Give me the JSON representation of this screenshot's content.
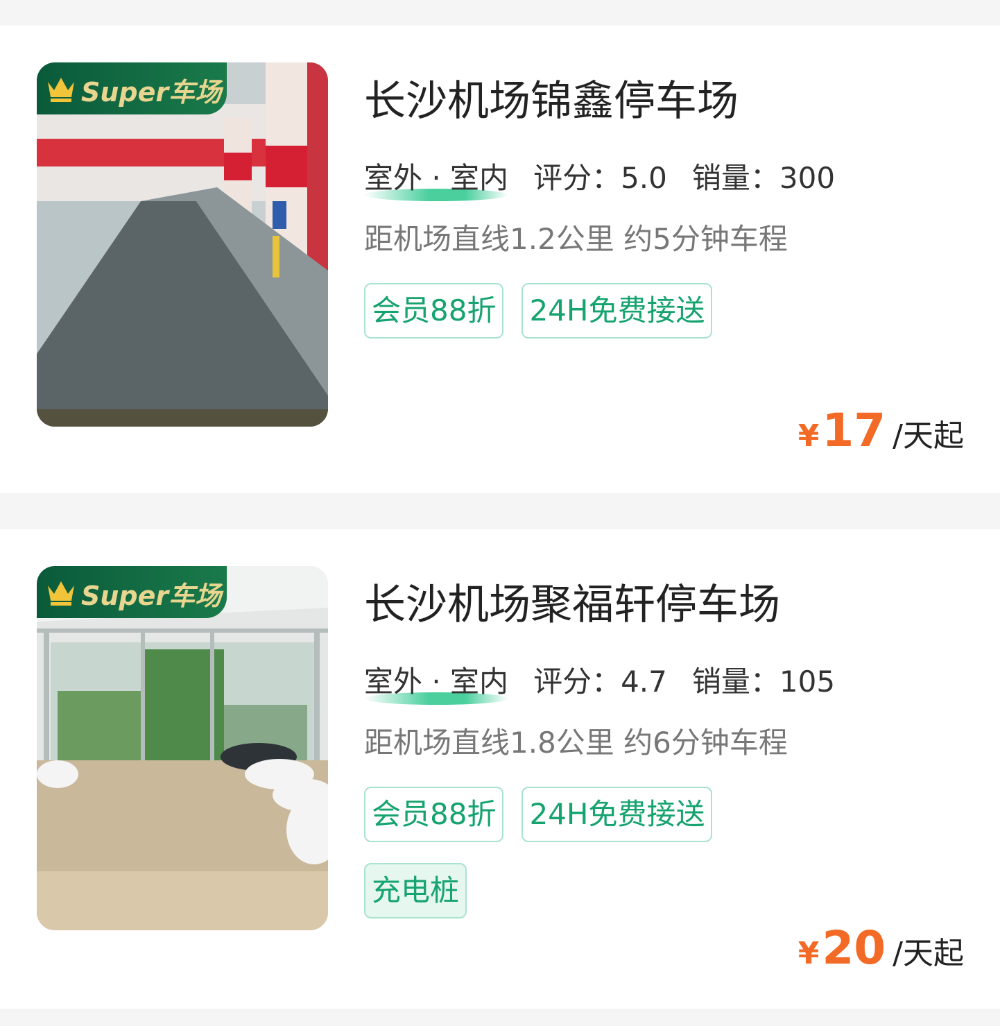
{
  "lots": [
    {
      "badge": "Super车场",
      "name": "长沙机场锦鑫停车场",
      "type_label": "室外 · 室内",
      "rating_label": "评分：",
      "rating": "5.0",
      "sales_label": "销量：",
      "sales": "300",
      "distance": "距机场直线1.2公里 约5分钟车程",
      "tags": [
        "会员88折",
        "24H免费接送"
      ],
      "currency": "¥",
      "price": "17",
      "price_unit": "/天起"
    },
    {
      "badge": "Super车场",
      "name": "长沙机场聚福轩停车场",
      "type_label": "室外 · 室内",
      "rating_label": "评分：",
      "rating": "4.7",
      "sales_label": "销量：",
      "sales": "105",
      "distance": "距机场直线1.8公里 约6分钟车程",
      "tags": [
        "会员88折",
        "24H免费接送",
        "充电桩"
      ],
      "currency": "¥",
      "price": "20",
      "price_unit": "/天起"
    }
  ],
  "colors": {
    "brand_green": "#15a36f",
    "price_orange": "#f26a25",
    "badge_green": "#0a5a3a"
  }
}
